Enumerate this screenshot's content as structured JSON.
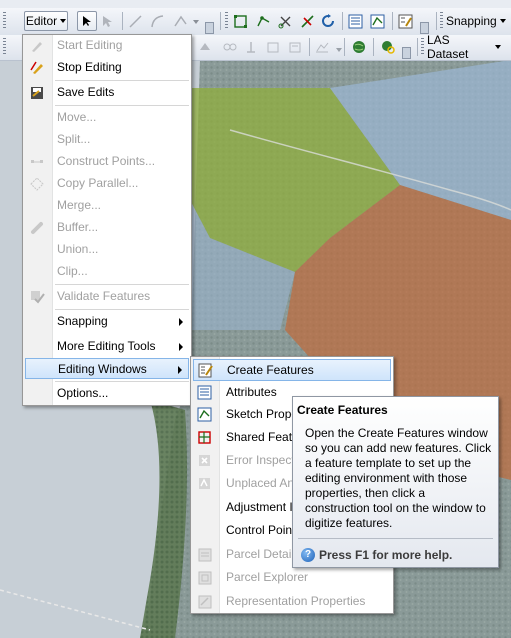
{
  "toolbar": {
    "editor_label": "Editor",
    "snapping_label": "Snapping",
    "las_label": "LAS Dataset"
  },
  "editor_menu": {
    "items": [
      {
        "label": "Start Editing",
        "enabled": false
      },
      {
        "label": "Stop Editing",
        "enabled": true
      },
      {
        "label": "Save Edits",
        "enabled": true
      },
      {
        "label": "Move...",
        "enabled": false
      },
      {
        "label": "Split...",
        "enabled": false
      },
      {
        "label": "Construct Points...",
        "enabled": false
      },
      {
        "label": "Copy Parallel...",
        "enabled": false
      },
      {
        "label": "Merge...",
        "enabled": false
      },
      {
        "label": "Buffer...",
        "enabled": false
      },
      {
        "label": "Union...",
        "enabled": false
      },
      {
        "label": "Clip...",
        "enabled": false
      },
      {
        "label": "Validate Features",
        "enabled": false
      },
      {
        "label": "Snapping",
        "enabled": true
      },
      {
        "label": "More Editing Tools",
        "enabled": true
      },
      {
        "label": "Editing Windows",
        "enabled": true
      },
      {
        "label": "Options...",
        "enabled": true
      }
    ]
  },
  "editing_windows_menu": {
    "items": [
      {
        "label": "Create Features",
        "enabled": true
      },
      {
        "label": "Attributes",
        "enabled": true
      },
      {
        "label": "Sketch Prope",
        "enabled": true
      },
      {
        "label": "Shared Featu",
        "enabled": true
      },
      {
        "label": "Error Inspect",
        "enabled": false
      },
      {
        "label": "Unplaced An",
        "enabled": false
      },
      {
        "label": "Adjustment I",
        "enabled": true
      },
      {
        "label": "Control Poin",
        "enabled": true
      },
      {
        "label": "Parcel Details",
        "enabled": false
      },
      {
        "label": "Parcel Explorer",
        "enabled": false
      },
      {
        "label": "Representation Properties",
        "enabled": false
      }
    ]
  },
  "tooltip": {
    "title": "Create Features",
    "body": "Open the Create Features window so you can add new features. Click a feature template to set up the editing environment with those properties, then click a construction tool on the window to digitize features.",
    "help": "Press F1 for more help."
  },
  "colors": {
    "highlight": "#cfe4fb",
    "green_overlay": "#8fae3c",
    "orange_overlay": "#c06a3a",
    "blue_overlay": "#9bb6d4"
  }
}
